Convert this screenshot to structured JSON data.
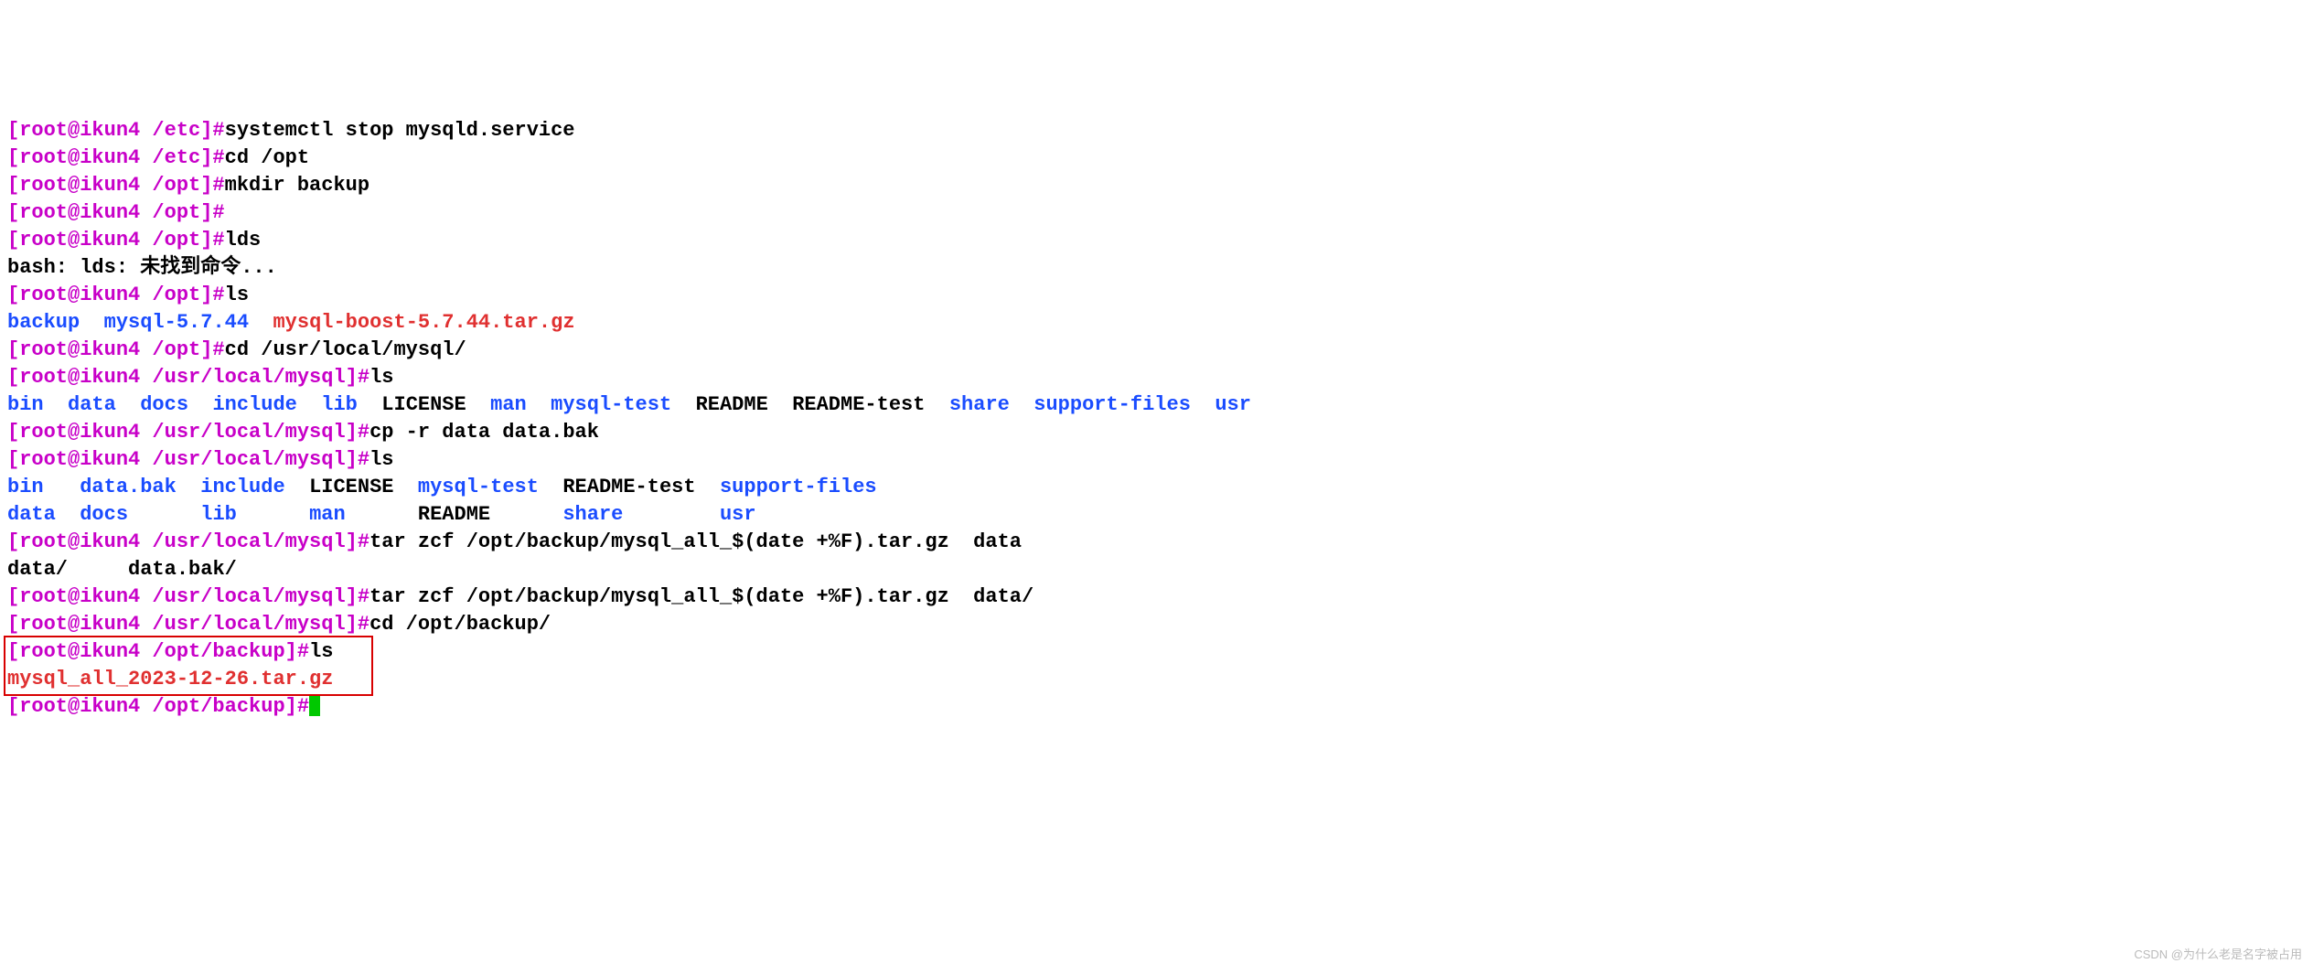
{
  "prompts": {
    "etc": "[root@ikun4 /etc]#",
    "opt": "[root@ikun4 /opt]#",
    "mysql": "[root@ikun4 /usr/local/mysql]#",
    "backup": "[root@ikun4 /opt/backup]#"
  },
  "cmds": {
    "stop": "systemctl stop mysqld.service",
    "cdopt": "cd /opt",
    "mkdir": "mkdir backup",
    "lds": "lds",
    "ls": "ls",
    "cdmysql": "cd /usr/local/mysql/",
    "cp": "cp -r data data.bak",
    "tar1": "tar zcf /opt/backup/mysql_all_$(date +%F).tar.gz  data",
    "tar2": "tar zcf /opt/backup/mysql_all_$(date +%F).tar.gz  data/",
    "cdbackup": "cd /opt/backup/"
  },
  "out": {
    "bash_err": "bash: lds: 未找到命令...",
    "ls_opt": {
      "backup": "backup",
      "mysql5744": "mysql-5.7.44",
      "boost": "mysql-boost-5.7.44.tar.gz"
    },
    "ls_mysql1": {
      "bin": "bin",
      "data": "data",
      "docs": "docs",
      "include": "include",
      "lib": "lib",
      "license": "LICENSE",
      "man": "man",
      "mysqltest": "mysql-test",
      "readme": "README",
      "readmetest": "README-test",
      "share": "share",
      "supportfiles": "support-files",
      "usr": "usr"
    },
    "ls_mysql2": {
      "bin": "bin",
      "databak": "data.bak",
      "include": "include",
      "license": "LICENSE",
      "mysqltest": "mysql-test",
      "readmetest": "README-test",
      "supportfiles": "support-files",
      "data": "data",
      "docs": "docs",
      "lib": "lib",
      "man": "man",
      "readme": "README",
      "share": "share",
      "usr": "usr"
    },
    "tarcomp": {
      "data": "data/",
      "databak": "data.bak/"
    },
    "ls_backup": "mysql_all_2023-12-26.tar.gz"
  },
  "watermark": "CSDN @为什么老是名字被占用"
}
